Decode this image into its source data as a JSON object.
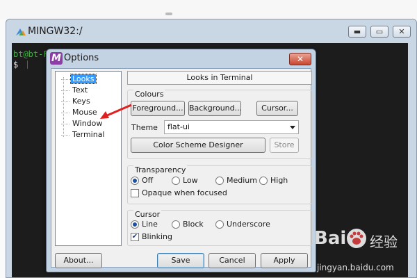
{
  "background_window": {
    "title": "MINGW32:/",
    "terminal_lines": [
      "bt@bt-F",
      "$"
    ]
  },
  "dialog": {
    "title": "Options",
    "tree": [
      "Looks",
      "Text",
      "Keys",
      "Mouse",
      "Window",
      "Terminal"
    ],
    "selected_tree_item": "Looks",
    "section_title": "Looks in Terminal",
    "colours": {
      "title": "Colours",
      "foreground_button": "Foreground...",
      "background_button": "Background...",
      "cursor_button": "Cursor...",
      "theme_label": "Theme",
      "theme_value": "flat-ui",
      "scheme_designer_button": "Color Scheme Designer",
      "store_button": "Store"
    },
    "transparency": {
      "title": "Transparency",
      "options": [
        "Off",
        "Low",
        "Medium",
        "High"
      ],
      "selected": "Off",
      "opaque_label": "Opaque when focused",
      "opaque_checked": false
    },
    "cursor": {
      "title": "Cursor",
      "options": [
        "Line",
        "Block",
        "Underscore"
      ],
      "selected": "Line",
      "blinking_label": "Blinking",
      "blinking_checked": true
    },
    "buttons": {
      "about": "About...",
      "save": "Save",
      "cancel": "Cancel",
      "apply": "Apply"
    }
  },
  "watermark": {
    "brand": "Bai",
    "brand_suffix": "经验",
    "url": "jingyan.baidu.com"
  },
  "colors": {
    "title_gradient": "#c9d6e4",
    "terminal_bg": "#1c1c1c",
    "prompt_green": "#3fb23f",
    "selection_blue": "#3399ff",
    "arrow_red": "#e02020",
    "close_red": "#c8452f"
  }
}
